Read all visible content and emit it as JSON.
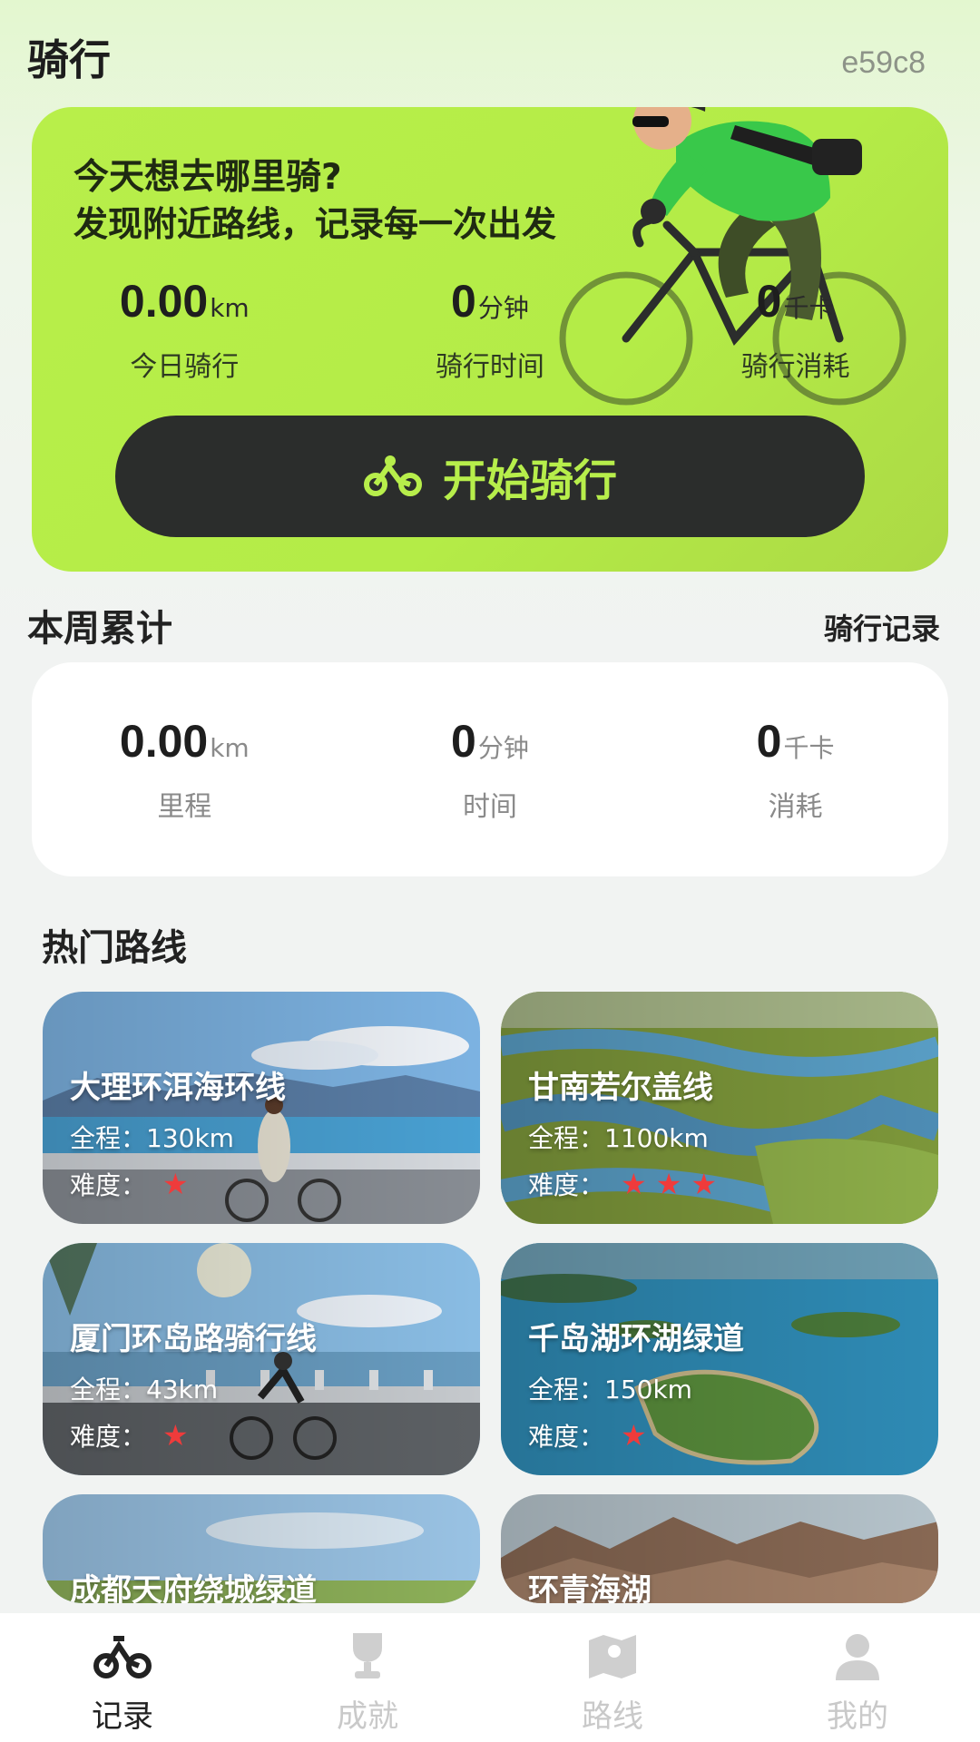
{
  "header": {
    "title": "骑行",
    "user_id": "e59c8"
  },
  "hero": {
    "line1": "今天想去哪里骑?",
    "line2": "发现附近路线，记录每一次出发",
    "stats": [
      {
        "value": "0.00",
        "unit": "km",
        "label": "今日骑行"
      },
      {
        "value": "0",
        "unit": "分钟",
        "label": "骑行时间"
      },
      {
        "value": "0",
        "unit": "千卡",
        "label": "骑行消耗"
      }
    ],
    "start_button": "开始骑行"
  },
  "weekly": {
    "title": "本周累计",
    "records_link": "骑行记录",
    "stats": [
      {
        "value": "0.00",
        "unit": "km",
        "label": "里程"
      },
      {
        "value": "0",
        "unit": "分钟",
        "label": "时间"
      },
      {
        "value": "0",
        "unit": "千卡",
        "label": "消耗"
      }
    ]
  },
  "routes": {
    "title": "热门路线",
    "items": [
      {
        "name": "大理环洱海环线",
        "distance": "全程：130km",
        "difficulty_label": "难度：",
        "stars": "★",
        "difficulty": 1
      },
      {
        "name": "甘南若尔盖线",
        "distance": "全程：1100km",
        "difficulty_label": "难度：",
        "stars": "★★★",
        "difficulty": 3
      },
      {
        "name": "厦门环岛路骑行线",
        "distance": "全程：43km",
        "difficulty_label": "难度：",
        "stars": "★",
        "difficulty": 1
      },
      {
        "name": "千岛湖环湖绿道",
        "distance": "全程：150km",
        "difficulty_label": "难度：",
        "stars": "★",
        "difficulty": 1
      },
      {
        "name": "成都天府绕城绿道"
      },
      {
        "name": "环青海湖"
      }
    ]
  },
  "nav": {
    "items": [
      {
        "label": "记录",
        "icon": "bike-icon",
        "active": true
      },
      {
        "label": "成就",
        "icon": "trophy-icon",
        "active": false
      },
      {
        "label": "路线",
        "icon": "map-icon",
        "active": false
      },
      {
        "label": "我的",
        "icon": "user-icon",
        "active": false
      }
    ]
  },
  "colors": {
    "accent": "#b7ee4b",
    "dark": "#2b2d2c",
    "star": "#ef3b3b"
  }
}
